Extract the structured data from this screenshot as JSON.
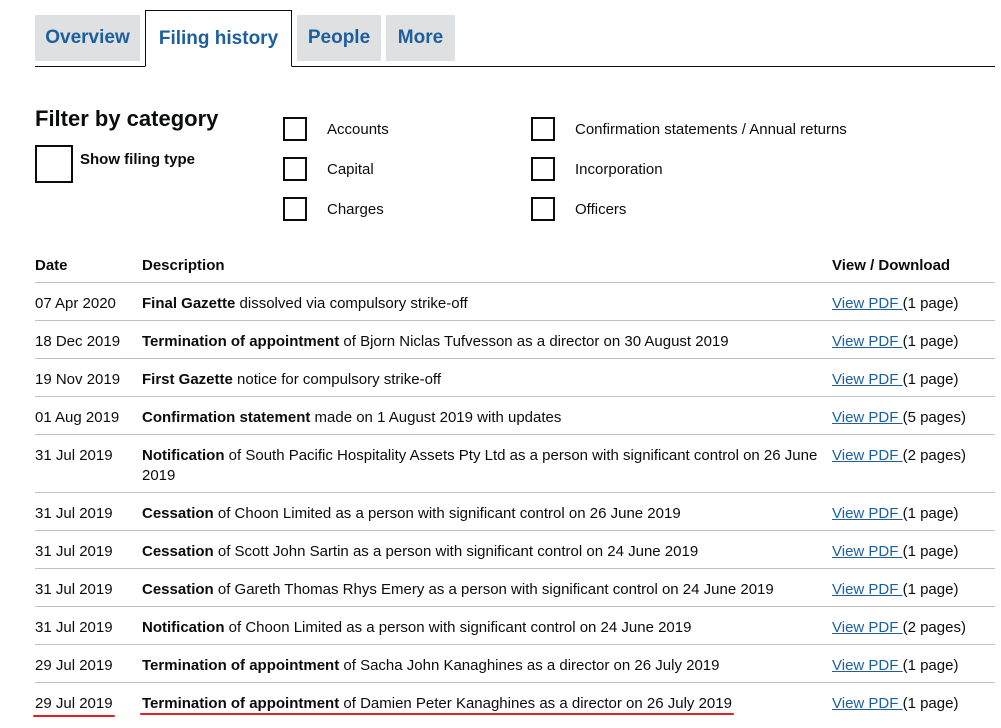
{
  "tabs": [
    "Overview",
    "Filing history",
    "People",
    "More"
  ],
  "filter": {
    "title": "Filter by category",
    "show_filing_type": "Show filing type",
    "categories": [
      "Accounts",
      "Capital",
      "Charges",
      "Confirmation statements / Annual returns",
      "Incorporation",
      "Officers"
    ]
  },
  "table": {
    "headers": {
      "date": "Date",
      "description": "Description",
      "view": "View / Download"
    },
    "link_label": "View PDF ",
    "rows": [
      {
        "date": "07 Apr 2020",
        "bold": "Final Gazette",
        "rest": " dissolved via compulsory strike-off",
        "pages": "(1 page)"
      },
      {
        "date": "18 Dec 2019",
        "bold": "Termination of appointment",
        "rest": " of Bjorn Niclas Tufvesson as a director on 30 August 2019",
        "pages": "(1 page)"
      },
      {
        "date": "19 Nov 2019",
        "bold": "First Gazette",
        "rest": " notice for compulsory strike-off",
        "pages": "(1 page)"
      },
      {
        "date": "01 Aug 2019",
        "bold": "Confirmation statement",
        "rest": " made on 1 August 2019 with updates",
        "pages": "(5 pages)"
      },
      {
        "date": "31 Jul 2019",
        "bold": "Notification",
        "rest": " of South Pacific Hospitality Assets Pty Ltd as a person with significant control on 26 June 2019",
        "pages": "(2 pages)"
      },
      {
        "date": "31 Jul 2019",
        "bold": "Cessation",
        "rest": " of Choon Limited as a person with significant control on 26 June 2019",
        "pages": "(1 page)"
      },
      {
        "date": "31 Jul 2019",
        "bold": "Cessation",
        "rest": " of Scott John Sartin as a person with significant control on 24 June 2019",
        "pages": "(1 page)"
      },
      {
        "date": "31 Jul 2019",
        "bold": "Cessation",
        "rest": " of Gareth Thomas Rhys Emery as a person with significant control on 24 June 2019",
        "pages": "(1 page)"
      },
      {
        "date": "31 Jul 2019",
        "bold": "Notification",
        "rest": " of Choon Limited as a person with significant control on 24 June 2019",
        "pages": "(2 pages)"
      },
      {
        "date": "29 Jul 2019",
        "bold": "Termination of appointment",
        "rest": " of Sacha John Kanaghines as a director on 26 July 2019",
        "pages": "(1 page)"
      },
      {
        "date": "29 Jul 2019",
        "bold": "Termination of appointment",
        "rest": " of Damien Peter Kanaghines as a director on 26 July 2019",
        "pages": "(1 page)"
      }
    ]
  },
  "colors": {
    "link": "#1d5e9c",
    "tab_bg": "#dee0e2",
    "highlight": "#e02020",
    "divider": "#bfc1c3"
  }
}
